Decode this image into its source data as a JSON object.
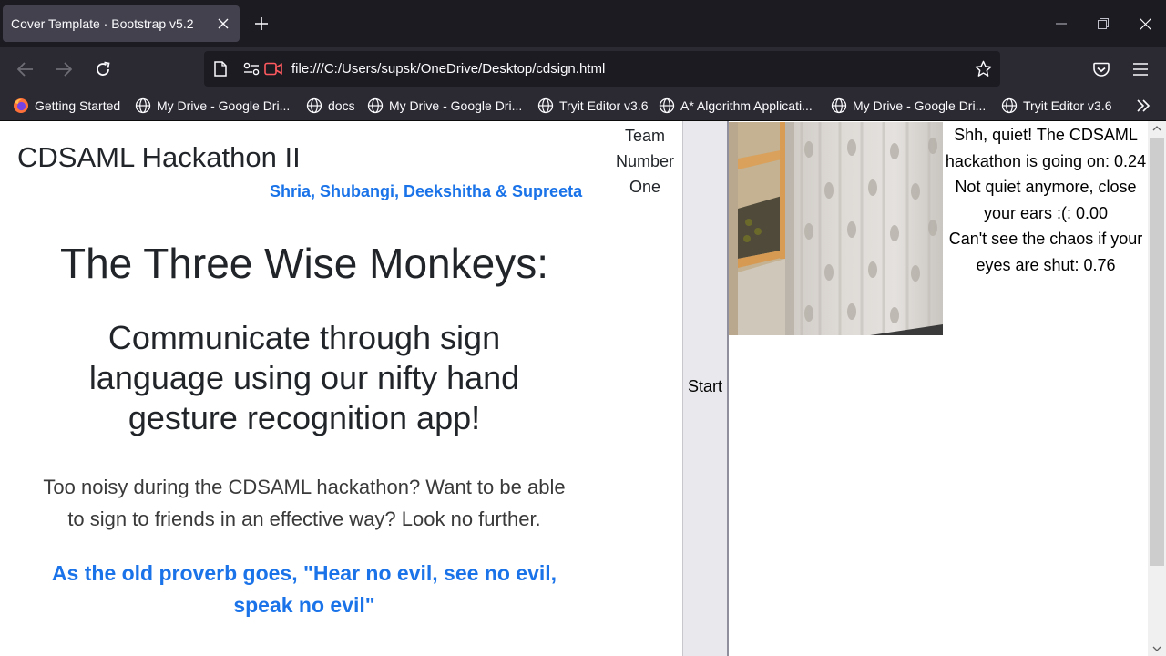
{
  "browser": {
    "tab_title": "Cover Template · Bootstrap v5.2",
    "url": "file:///C:/Users/supsk/OneDrive/Desktop/cdsign.html",
    "bookmarks": [
      {
        "label": "Getting Started",
        "icon": "firefox-icon"
      },
      {
        "label": "My Drive - Google Dri...",
        "icon": "globe-icon"
      },
      {
        "label": "docs",
        "icon": "globe-icon"
      },
      {
        "label": "My Drive - Google Dri...",
        "icon": "globe-icon"
      },
      {
        "label": "Tryit Editor v3.6",
        "icon": "globe-icon"
      },
      {
        "label": "A* Algorithm Applicati...",
        "icon": "globe-icon"
      },
      {
        "label": "My Drive - Google Dri...",
        "icon": "globe-icon"
      },
      {
        "label": "Tryit Editor v3.6",
        "icon": "globe-icon"
      }
    ]
  },
  "page": {
    "brand": "CDSAML Hackathon II",
    "authors": "Shria, Shubangi, Deekshitha & Supreeta",
    "team": [
      "Team",
      "Number",
      "One"
    ],
    "headline": "The Three Wise Monkeys:",
    "subheadline": "Communicate through sign language using our nifty hand gesture recognition app!",
    "lead": "Too noisy during the CDSAML hackathon? Want to be able to sign to friends in an effective way? Look no further.",
    "proverb": "As the old proverb goes, \"Hear no evil, see no evil, speak no evil\"",
    "start_button": "Start",
    "readouts": {
      "quiet_label": "Shh, quiet! The CDSAML hackathon is going on:",
      "quiet_value": "0.24",
      "loud_label": "Not quiet anymore, close your ears :(:",
      "loud_value": "0.00",
      "eyes_label": "Can't see the chaos if your eyes are shut:",
      "eyes_value": "0.76"
    }
  },
  "colors": {
    "accent": "#1a73e8",
    "text": "#212529",
    "chrome_dark": "#1c1b22",
    "chrome_mid": "#2b2a33"
  }
}
